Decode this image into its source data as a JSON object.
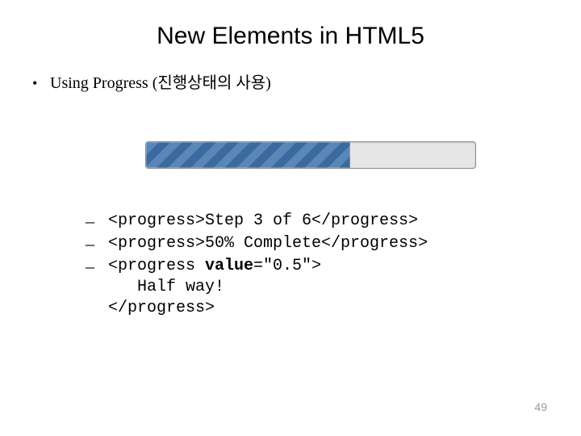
{
  "title": "New Elements in HTML5",
  "bullet": {
    "text_a": "Using ",
    "text_b": "Progress",
    "text_c": " (진행상태의 사용)"
  },
  "progress": {
    "percent": 62
  },
  "code": {
    "line1": "<progress>Step 3 of 6</progress>",
    "line2": "<progress>50% Complete</progress>",
    "line3_a": "<progress ",
    "line3_b_bold": "value",
    "line3_c": "=\"0.5\">",
    "line4": "   Half way!",
    "line5": "</progress>"
  },
  "pageNumber": "49"
}
